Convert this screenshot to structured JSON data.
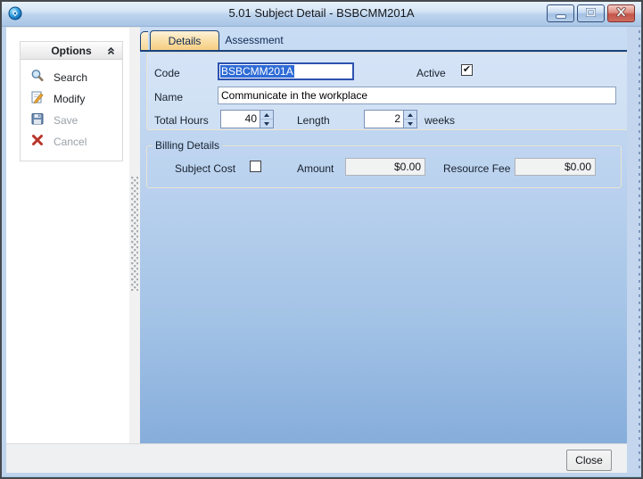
{
  "window": {
    "title": "5.01 Subject Detail - BSBCMM201A"
  },
  "sidebar": {
    "header": "Options",
    "items": [
      {
        "label": "Search",
        "icon": "search-icon",
        "disabled": false
      },
      {
        "label": "Modify",
        "icon": "modify-icon",
        "disabled": false
      },
      {
        "label": "Save",
        "icon": "save-icon",
        "disabled": true
      },
      {
        "label": "Cancel",
        "icon": "cancel-icon",
        "disabled": true
      }
    ]
  },
  "tabs": [
    {
      "label": "Details",
      "active": true
    },
    {
      "label": "Assessment",
      "active": false
    }
  ],
  "form": {
    "code_label": "Code",
    "code_value": "BSBCMM201A",
    "active_label": "Active",
    "active_checked": true,
    "name_label": "Name",
    "name_value": "Communicate in the workplace",
    "total_hours_label": "Total Hours",
    "total_hours_value": "40",
    "length_label": "Length",
    "length_value": "2",
    "length_unit": "weeks"
  },
  "billing": {
    "legend": "Billing Details",
    "subject_cost_label": "Subject Cost",
    "subject_cost_checked": false,
    "amount_label": "Amount",
    "amount_value": "$0.00",
    "resource_fee_label": "Resource Fee",
    "resource_fee_value": "$0.00"
  },
  "footer": {
    "close_label": "Close"
  },
  "colors": {
    "titlebar_top": "#eaf3fc",
    "titlebar_bottom": "#a9c5e6",
    "content_top": "#c9dcf4",
    "content_bottom": "#86addb",
    "active_tab": "#f8d894",
    "tab_border": "#1a4379",
    "selection_blue": "#2e6bd6",
    "close_button_red": "#c4564a"
  }
}
